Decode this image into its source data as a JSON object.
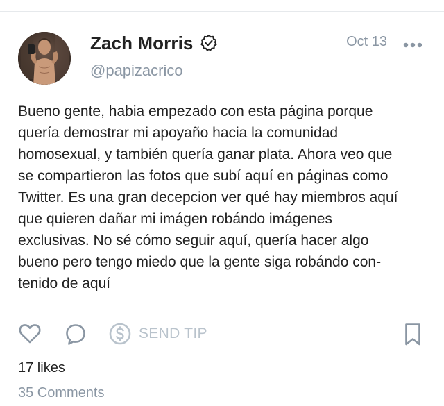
{
  "post": {
    "author": {
      "display_name": "Zach Morris",
      "handle": "@papizacrico",
      "verified": true
    },
    "date": "Oct 13",
    "text": "Bueno gente, habia empezado con esta página porque\nquería demostrar mi apoyaño hacia la comunidad\nhomosexual, y también quería ganar plata. Ahora veo que\nse compartieron las fotos que subí aquí en páginas como\nTwitter. Es una gran decepcion ver qué hay miembros aquí\nque quieren dañar mi imágen robándo imágenes\nexclusivas. No sé cómo seguir aquí, quería hacer algo\nbueno pero tengo miedo que la gente siga robándo con-\ntenido de aquí",
    "actions": {
      "send_tip_label": "SEND TIP"
    },
    "likes_label": "17 likes",
    "comments_label": "35 Comments"
  },
  "colors": {
    "text": "#222222",
    "muted": "#8a96a3",
    "icon": "#8a96a3",
    "tip_disabled": "#b9c3cc"
  },
  "icons": {
    "verified": "verified-badge-icon",
    "more": "more-horizontal-icon",
    "like": "heart-outline-icon",
    "comment": "comment-bubble-icon",
    "tip": "dollar-circle-icon",
    "bookmark": "bookmark-outline-icon"
  }
}
